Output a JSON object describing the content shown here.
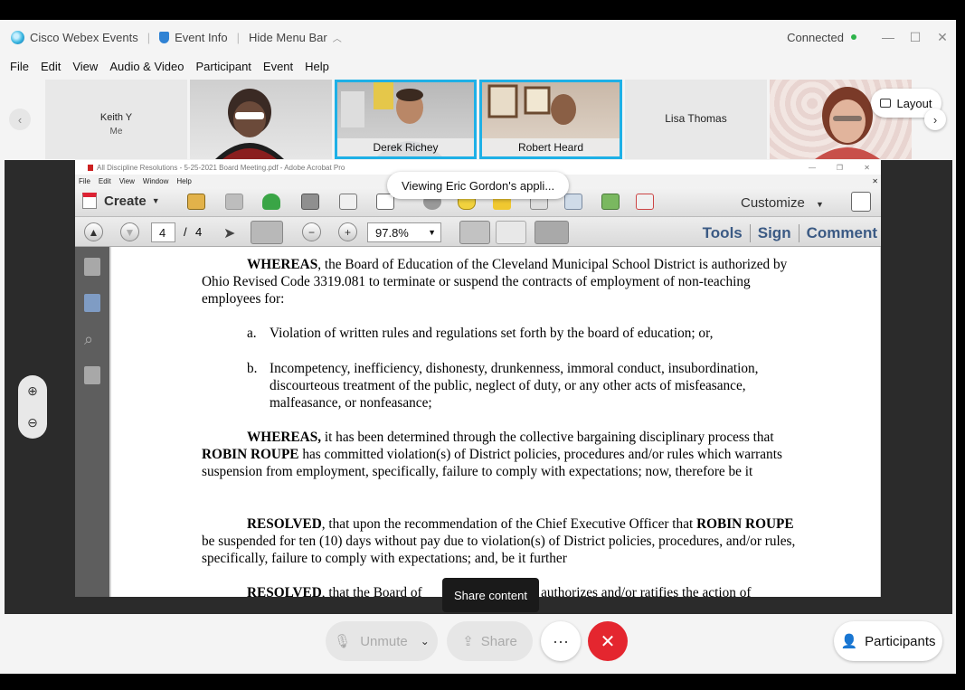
{
  "titlebar": {
    "app_name": "Cisco Webex Events",
    "event_info": "Event Info",
    "hide_menu": "Hide Menu Bar",
    "status": "Connected"
  },
  "menu": [
    "File",
    "Edit",
    "View",
    "Audio & Video",
    "Participant",
    "Event",
    "Help"
  ],
  "participants": [
    {
      "name": "Keith Y",
      "sub": "Me"
    },
    {
      "name": ""
    },
    {
      "name": "Derek Richey"
    },
    {
      "name": "Robert Heard"
    },
    {
      "name": "Lisa Thomas"
    },
    {
      "name": ""
    }
  ],
  "layout_label": "Layout",
  "viewing_label": "Viewing Eric Gordon's appli...",
  "acrobat": {
    "title": "All Discipline Resolutions - 5-25-2021 Board Meeting.pdf - Adobe Acrobat Pro",
    "menu": [
      "File",
      "Edit",
      "View",
      "Window",
      "Help"
    ],
    "create_label": "Create",
    "customize_label": "Customize",
    "page_current": "4",
    "page_sep": "/",
    "page_total": "4",
    "zoom": "97.8%",
    "links": [
      "Tools",
      "Sign",
      "Comment"
    ]
  },
  "document": {
    "p1_bold": "WHEREAS",
    "p1_text": ", the Board of Education of the Cleveland Municipal School District is authorized by Ohio Revised Code 3319.081 to terminate or suspend the contracts of employment of non-teaching employees for:",
    "item_a_letter": "a.",
    "item_a": "Violation of written rules and regulations set forth by the board of education; or,",
    "item_b_letter": "b.",
    "item_b": "Incompetency, inefficiency, dishonesty, drunkenness, immoral conduct, insubordination, discourteous treatment of the public, neglect of duty, or any other acts of misfeasance, malfeasance, or nonfeasance;",
    "p2_bold": "WHEREAS,",
    "p2_text1": " it has been determined through the collective bargaining disciplinary process that ",
    "p2_name": "ROBIN ROUPE",
    "p2_text2": " has committed violation(s) of District policies, procedures and/or rules which warrants suspension from employment, specifically, failure to comply with expectations; now, therefore be it",
    "p3_bold": "RESOLVED",
    "p3_text1": ", that upon the recommendation of the Chief Executive Officer that ",
    "p3_name": "ROBIN ROUPE",
    "p3_text2": " be suspended for ten (10) days without pay due to violation(s) of District policies, procedures, and/or rules, specifically, failure to comply with expectations; and, be it further",
    "p4_bold": "RESOLVED",
    "p4_text": ", that the Board of",
    "p4_tail": "y authorizes and/or ratifies the action of"
  },
  "tooltip": "Share content",
  "controls": {
    "unmute": "Unmute",
    "share": "Share",
    "more": "···",
    "participants": "Participants"
  }
}
